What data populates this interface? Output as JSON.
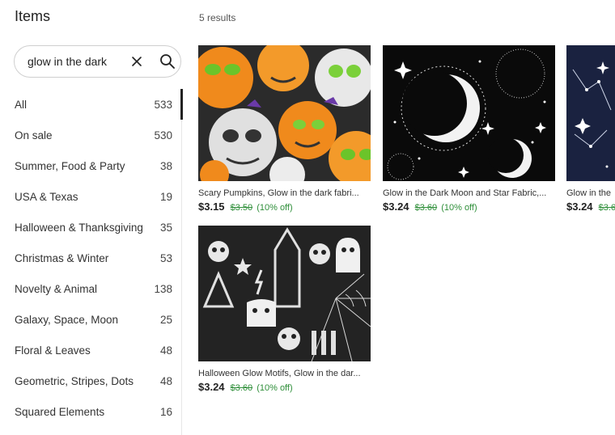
{
  "header": {
    "title": "Items",
    "results": "5 results"
  },
  "search": {
    "value": "glow in the dark"
  },
  "categories": [
    {
      "label": "All",
      "count": "533"
    },
    {
      "label": "On sale",
      "count": "530"
    },
    {
      "label": "Summer, Food & Party",
      "count": "38"
    },
    {
      "label": "USA & Texas",
      "count": "19"
    },
    {
      "label": "Halloween & Thanksgiving",
      "count": "35"
    },
    {
      "label": "Christmas & Winter",
      "count": "53"
    },
    {
      "label": "Novelty & Animal",
      "count": "138"
    },
    {
      "label": "Galaxy, Space, Moon",
      "count": "25"
    },
    {
      "label": "Floral & Leaves",
      "count": "48"
    },
    {
      "label": "Geometric, Stripes, Dots",
      "count": "48"
    },
    {
      "label": "Squared Elements",
      "count": "16"
    }
  ],
  "items": [
    {
      "title": "Scary Pumpkins, Glow in the dark fabri...",
      "price": "$3.15",
      "old_price": "$3.50",
      "discount": "(10% off)"
    },
    {
      "title": "Glow in the Dark Moon and Star Fabric,...",
      "price": "$3.24",
      "old_price": "$3.60",
      "discount": "(10% off)"
    },
    {
      "title": "Glow in the",
      "price": "$3.24",
      "old_price": "$3.6"
    },
    {
      "title": "Halloween Glow Motifs, Glow in the dar...",
      "price": "$3.24",
      "old_price": "$3.60",
      "discount": "(10% off)"
    }
  ],
  "colors": {
    "sale_green": "#2f8f3a",
    "active_bar": "#222222",
    "border": "#cfcfcf"
  },
  "icons": {
    "clear": "close-icon",
    "search": "search-icon"
  }
}
